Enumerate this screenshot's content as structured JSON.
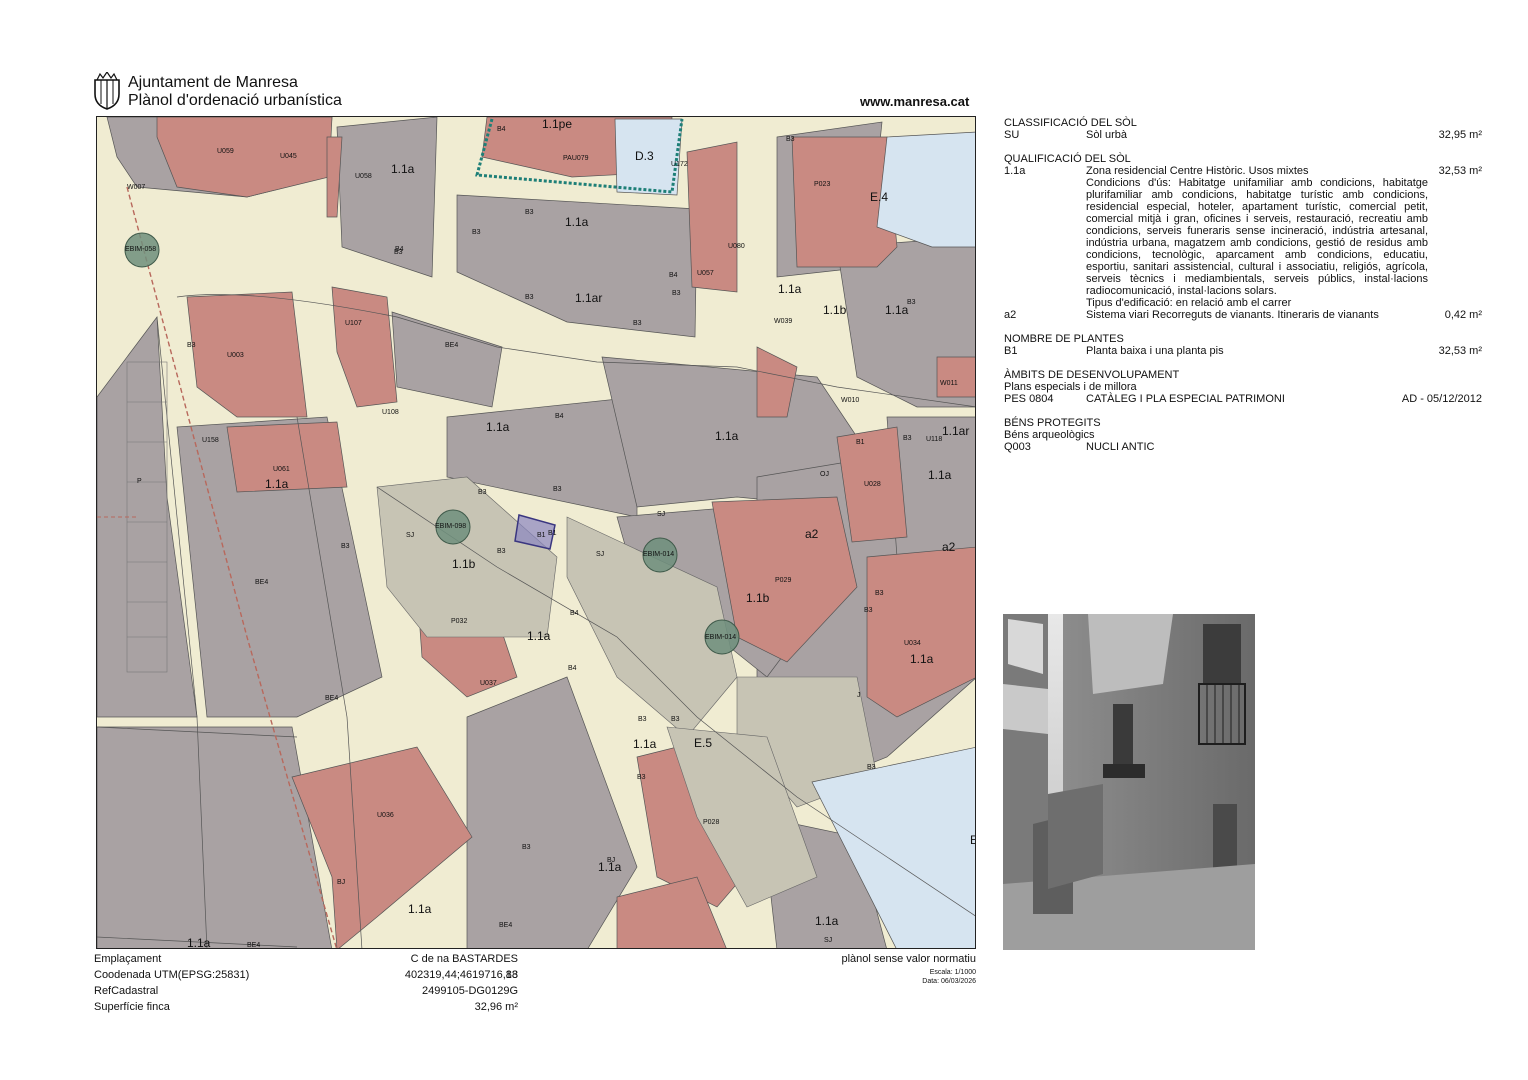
{
  "header": {
    "org": "Ajuntament de Manresa",
    "plan": "Plànol d'ordenació urbanística",
    "url": "www.manresa.cat"
  },
  "colors": {
    "street": "#f0ecd2",
    "block_grey": "#a9a2a3",
    "block_red": "#c98a82",
    "equipment_blue": "#d6e4f0",
    "light_block": "#c7c4b4",
    "bim_circle": "#6f8f7c",
    "plot_highlight": "#6e6aa8",
    "dashed_line": "#b8685c",
    "pau_dotted": "#1e7f77"
  },
  "map": {
    "icons": [
      "manresa-shield-icon"
    ],
    "zone_labels": [
      "1.1pe",
      "D.3",
      "E.4",
      "1.1a",
      "1.1a",
      "1.1ar",
      "1.1a",
      "1.1b",
      "1.1a",
      "1.1a",
      "1.1a",
      "1.1ar",
      "1.1a",
      "a2",
      "1.1a",
      "1.1b",
      "1.1b",
      "1.1a",
      "1.1a",
      "E.5",
      "1.1a",
      "1.1a",
      "1.1a",
      "1.1a",
      "a2",
      "1.1a",
      "E"
    ],
    "codes": [
      "U059",
      "U045",
      "U058",
      "U172",
      "P023",
      "W007",
      "PAU079",
      "U080",
      "U057",
      "U003",
      "U107",
      "W039",
      "U108",
      "W010",
      "W011",
      "U118",
      "U158",
      "U061",
      "U028",
      "P029",
      "P032",
      "U037",
      "U034",
      "U036",
      "P028",
      "B4",
      "B3",
      "B3",
      "B3",
      "B3",
      "B3",
      "B4",
      "B3",
      "B3",
      "B3",
      "BE4",
      "B4",
      "B3",
      "B3",
      "B3",
      "B1",
      "B1",
      "B3",
      "BE4",
      "BE4",
      "BE4",
      "SJ",
      "SJ",
      "SJ",
      "OJ",
      "J",
      "P",
      "BJ",
      "BJ",
      "B3",
      "B3",
      "B3",
      "B3",
      "B3",
      "SJ",
      "B4",
      "B4",
      "BE4",
      "B3",
      "B4",
      "B3",
      "B3",
      "B3"
    ],
    "bim_markers": [
      "EBIM-058",
      "EBIM-098",
      "EBIM-014",
      "EBIM-014"
    ],
    "plot_label": "B1"
  },
  "footer": {
    "emplacament_label": "Emplaçament",
    "emplacament_value": "C de na BASTARDES 18",
    "utm_label": "Coodenada UTM(EPSG:25831)",
    "utm_value": "402319,44;4619716,83",
    "ref_label": "RefCadastral",
    "ref_value": "2499105-DG0129G",
    "sup_label": "Superfície finca",
    "sup_value": "32,96 m²",
    "note": "plànol sense valor normatiu",
    "scale": "Escala: 1/1000",
    "date": "Data: 06/03/2026"
  },
  "panel": {
    "classificacio": {
      "title": "CLASSIFICACIÓ DEL SÒL",
      "code": "SU",
      "desc": "Sòl urbà",
      "value": "32,95 m²"
    },
    "qualificacio": {
      "title": "QUALIFICACIÓ DEL SÒL",
      "code": "1.1a",
      "desc": "Zona residencial Centre Històric. Usos mixtes",
      "value": "32,53 m²",
      "conditions": "Condicions d'ús: Habitatge unifamiliar amb condicions, habitatge plurifamiliar amb condicions, habitatge turístic amb condicions, residencial especial, hoteler, apartament turístic, comercial petit, comercial mitjà i gran, oficines i serveis, restauració, recreatiu amb condicions, serveis funeraris sense incineració, indústria artesanal, indústria urbana, magatzem amb condicions, gestió de residus amb condicions, tecnològic, aparcament amb condicions, educatiu, esportiu, sanitari assistencial, cultural i associatiu, religiós, agrícola, serveis tècnics i mediambientals, serveis públics, instal·lacions radiocomunicació, instal·lacions solars.",
      "tipus": "Tipus d'edificació: en relació amb el carrer",
      "code2": "a2",
      "desc2": "Sistema viari Recorreguts de vianants. Itineraris de vianants",
      "value2": "0,42 m²"
    },
    "plantes": {
      "title": "NOMBRE DE PLANTES",
      "code": "B1",
      "desc": "Planta baixa i una planta pis",
      "value": "32,53 m²"
    },
    "ambits": {
      "title": "ÀMBITS DE DESENVOLUPAMENT",
      "subtitle": "Plans especials i de millora",
      "code": "PES 0804",
      "desc": "CATÀLEG I PLA ESPECIAL PATRIMONI",
      "value": "AD - 05/12/2012"
    },
    "bens": {
      "title": "BÉNS PROTEGITS",
      "subtitle": "Béns arqueològics",
      "code": "Q003",
      "desc": "NUCLI ANTIC"
    }
  }
}
